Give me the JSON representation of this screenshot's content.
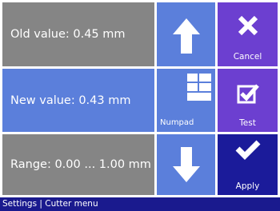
{
  "info": {
    "old_value": "Old value: 0.45 mm",
    "new_value": "New value: 0.43 mm",
    "range": "Range: 0.00 ... 1.00 mm"
  },
  "controls": {
    "up_icon": "arrow-up-icon",
    "down_icon": "arrow-down-icon",
    "numpad_label": "Numpad",
    "numpad_icon": "numpad-icon"
  },
  "actions": {
    "cancel_label": "Cancel",
    "cancel_icon": "close-icon",
    "test_label": "Test",
    "test_icon": "checkbox-icon",
    "apply_label": "Apply",
    "apply_icon": "checkmark-icon"
  },
  "statusbar": {
    "text": "Settings | Cutter menu"
  },
  "colors": {
    "grey": "#858585",
    "blue": "#5b7fdb",
    "purple": "#6c3fd0",
    "navy": "#1b1b9a",
    "statusbar": "#1a1a8e"
  }
}
